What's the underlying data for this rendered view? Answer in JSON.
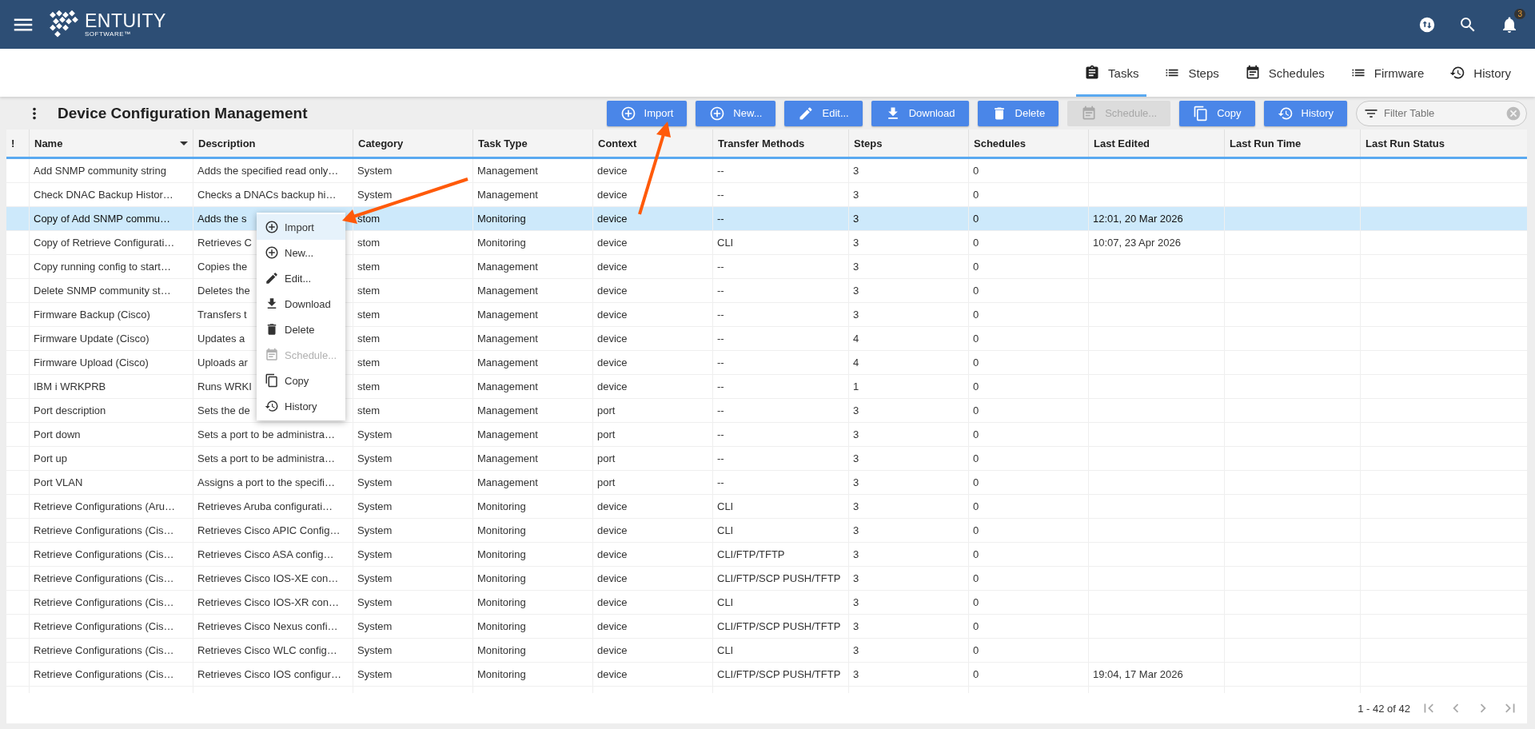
{
  "header": {
    "logo": {
      "name": "ENTUITY",
      "tagline": "SOFTWARE™"
    },
    "notification_count": "3"
  },
  "tabs": [
    {
      "label": "Tasks",
      "selected": true
    },
    {
      "label": "Steps",
      "selected": false
    },
    {
      "label": "Schedules",
      "selected": false
    },
    {
      "label": "Firmware",
      "selected": false
    },
    {
      "label": "History",
      "selected": false
    }
  ],
  "page": {
    "title": "Device Configuration Management"
  },
  "toolbar": {
    "buttons": [
      {
        "label": "Import",
        "disabled": false
      },
      {
        "label": "New...",
        "disabled": false
      },
      {
        "label": "Edit...",
        "disabled": false
      },
      {
        "label": "Download",
        "disabled": false
      },
      {
        "label": "Delete",
        "disabled": false
      },
      {
        "label": "Schedule...",
        "disabled": true
      },
      {
        "label": "Copy",
        "disabled": false
      },
      {
        "label": "History",
        "disabled": false
      }
    ],
    "filter": {
      "placeholder": "Filter Table"
    }
  },
  "table": {
    "columns": [
      {
        "label": "!",
        "sorted": false
      },
      {
        "label": "Name",
        "sorted": true
      },
      {
        "label": "Description",
        "sorted": false
      },
      {
        "label": "Category",
        "sorted": false
      },
      {
        "label": "Task Type",
        "sorted": false
      },
      {
        "label": "Context",
        "sorted": false
      },
      {
        "label": "Transfer Methods",
        "sorted": false
      },
      {
        "label": "Steps",
        "sorted": false
      },
      {
        "label": "Schedules",
        "sorted": false
      },
      {
        "label": "Last Edited",
        "sorted": false
      },
      {
        "label": "Last Run Time",
        "sorted": false
      },
      {
        "label": "Last Run Status",
        "sorted": false
      }
    ],
    "rows": [
      {
        "selected": false,
        "name": "Add SNMP community string",
        "description": "Adds the specified read only…",
        "category": "System",
        "task_type": "Management",
        "context": "device",
        "transfer_methods": "--",
        "steps": "3",
        "schedules": "0"
      },
      {
        "selected": false,
        "name": "Check DNAC Backup Histor…",
        "description": "Checks a DNACs backup hi…",
        "category": "System",
        "task_type": "Management",
        "context": "device",
        "transfer_methods": "--",
        "steps": "3",
        "schedules": "0"
      },
      {
        "selected": true,
        "name": "Copy of Add SNMP commu…",
        "description": "Adds the s",
        "category": "stom",
        "task_type": "Monitoring",
        "context": "device",
        "transfer_methods": "--",
        "steps": "3",
        "schedules": "0",
        "last_edited": "12:01, 20 Mar 2026"
      },
      {
        "selected": false,
        "name": "Copy of Retrieve Configurati…",
        "description": "Retrieves C",
        "category": "stom",
        "task_type": "Monitoring",
        "context": "device",
        "transfer_methods": "CLI",
        "steps": "3",
        "schedules": "0",
        "last_edited": "10:07, 23 Apr 2026"
      },
      {
        "selected": false,
        "name": "Copy running config to start…",
        "description": "Copies the",
        "category": "stem",
        "task_type": "Management",
        "context": "device",
        "transfer_methods": "--",
        "steps": "3",
        "schedules": "0"
      },
      {
        "selected": false,
        "name": "Delete SNMP community st…",
        "description": "Deletes the",
        "category": "stem",
        "task_type": "Management",
        "context": "device",
        "transfer_methods": "--",
        "steps": "3",
        "schedules": "0"
      },
      {
        "selected": false,
        "name": "Firmware Backup (Cisco)",
        "description": "Transfers t",
        "category": "stem",
        "task_type": "Management",
        "context": "device",
        "transfer_methods": "--",
        "steps": "3",
        "schedules": "0"
      },
      {
        "selected": false,
        "name": "Firmware Update (Cisco)",
        "description": "Updates a",
        "category": "stem",
        "task_type": "Management",
        "context": "device",
        "transfer_methods": "--",
        "steps": "4",
        "schedules": "0"
      },
      {
        "selected": false,
        "name": "Firmware Upload (Cisco)",
        "description": "Uploads ar",
        "category": "stem",
        "task_type": "Management",
        "context": "device",
        "transfer_methods": "--",
        "steps": "4",
        "schedules": "0"
      },
      {
        "selected": false,
        "name": "IBM i WRKPRB",
        "description": "Runs WRKI",
        "category": "stem",
        "task_type": "Management",
        "context": "device",
        "transfer_methods": "--",
        "steps": "1",
        "schedules": "0"
      },
      {
        "selected": false,
        "name": "Port description",
        "description": "Sets the de",
        "category": "stem",
        "task_type": "Management",
        "context": "port",
        "transfer_methods": "--",
        "steps": "3",
        "schedules": "0"
      },
      {
        "selected": false,
        "name": "Port down",
        "description": "Sets a port to be administra…",
        "category": "System",
        "task_type": "Management",
        "context": "port",
        "transfer_methods": "--",
        "steps": "3",
        "schedules": "0"
      },
      {
        "selected": false,
        "name": "Port up",
        "description": "Sets a port to be administra…",
        "category": "System",
        "task_type": "Management",
        "context": "port",
        "transfer_methods": "--",
        "steps": "3",
        "schedules": "0"
      },
      {
        "selected": false,
        "name": "Port VLAN",
        "description": "Assigns a port to the specifi…",
        "category": "System",
        "task_type": "Management",
        "context": "port",
        "transfer_methods": "--",
        "steps": "3",
        "schedules": "0"
      },
      {
        "selected": false,
        "name": "Retrieve Configurations (Aru…",
        "description": "Retrieves Aruba configurati…",
        "category": "System",
        "task_type": "Monitoring",
        "context": "device",
        "transfer_methods": "CLI",
        "steps": "3",
        "schedules": "0"
      },
      {
        "selected": false,
        "name": "Retrieve Configurations (Cis…",
        "description": "Retrieves Cisco APIC Config…",
        "category": "System",
        "task_type": "Monitoring",
        "context": "device",
        "transfer_methods": "CLI",
        "steps": "3",
        "schedules": "0"
      },
      {
        "selected": false,
        "name": "Retrieve Configurations (Cis…",
        "description": "Retrieves Cisco ASA config…",
        "category": "System",
        "task_type": "Monitoring",
        "context": "device",
        "transfer_methods": "CLI/FTP/TFTP",
        "steps": "3",
        "schedules": "0"
      },
      {
        "selected": false,
        "name": "Retrieve Configurations (Cis…",
        "description": "Retrieves Cisco IOS-XE con…",
        "category": "System",
        "task_type": "Monitoring",
        "context": "device",
        "transfer_methods": "CLI/FTP/SCP PUSH/TFTP",
        "steps": "3",
        "schedules": "0"
      },
      {
        "selected": false,
        "name": "Retrieve Configurations (Cis…",
        "description": "Retrieves Cisco IOS-XR con…",
        "category": "System",
        "task_type": "Monitoring",
        "context": "device",
        "transfer_methods": "CLI",
        "steps": "3",
        "schedules": "0"
      },
      {
        "selected": false,
        "name": "Retrieve Configurations (Cis…",
        "description": "Retrieves Cisco Nexus confi…",
        "category": "System",
        "task_type": "Monitoring",
        "context": "device",
        "transfer_methods": "CLI/FTP/SCP PUSH/TFTP",
        "steps": "3",
        "schedules": "0"
      },
      {
        "selected": false,
        "name": "Retrieve Configurations (Cis…",
        "description": "Retrieves Cisco WLC config…",
        "category": "System",
        "task_type": "Monitoring",
        "context": "device",
        "transfer_methods": "CLI",
        "steps": "3",
        "schedules": "0"
      },
      {
        "selected": false,
        "name": "Retrieve Configurations (Cis…",
        "description": "Retrieves Cisco IOS configur…",
        "category": "System",
        "task_type": "Monitoring",
        "context": "device",
        "transfer_methods": "CLI/FTP/SCP PUSH/TFTP",
        "steps": "3",
        "schedules": "0",
        "last_edited": "19:04, 17 Mar 2026"
      }
    ]
  },
  "context_menu": {
    "items": [
      {
        "label": "Import",
        "selected": true,
        "disabled": false
      },
      {
        "label": "New...",
        "selected": false,
        "disabled": false
      },
      {
        "label": "Edit...",
        "selected": false,
        "disabled": false
      },
      {
        "label": "Download",
        "selected": false,
        "disabled": false
      },
      {
        "label": "Delete",
        "selected": false,
        "disabled": false
      },
      {
        "label": "Schedule...",
        "selected": false,
        "disabled": true
      },
      {
        "label": "Copy",
        "selected": false,
        "disabled": false
      },
      {
        "label": "History",
        "selected": false,
        "disabled": false
      }
    ]
  },
  "pagination": {
    "range": "1 - 42 of 42"
  }
}
